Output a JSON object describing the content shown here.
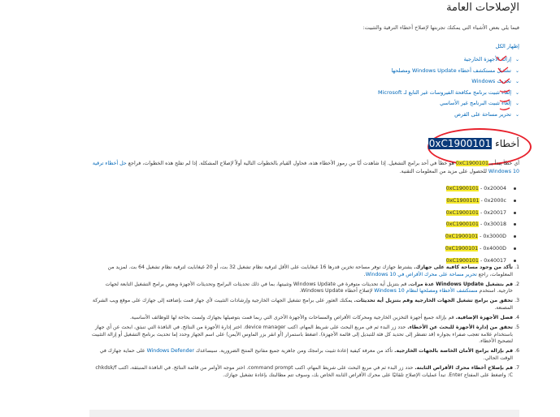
{
  "heading": "الإصلاحات العامة",
  "intro": "فيما يلي بعض الأشياء التي يمكنك تجربتها لإصلاح أخطاء الترقية والتثبيت:",
  "expand_all": "إظهار الكل",
  "fixes": [
    {
      "label": "إزالة الأجهزة الخارجية"
    },
    {
      "label": "تشغيل مستكشف أخطاء Windows Update ومصلحها"
    },
    {
      "label": "تحديث Windows"
    },
    {
      "label": "إلغاء تثبيت برنامج مكافحة الفيروسات غير التابع لـ Microsoft"
    },
    {
      "label": "إلغاء تثبيت البرنامج غير الأساسي"
    },
    {
      "label": "تحرير مساحة على القرص"
    }
  ],
  "error": {
    "title_prefix": "أخطاء",
    "code": "0xC1900101"
  },
  "paragraph": {
    "a": "أي خطأ يبدأ بـ ",
    "code": "0xC1900101",
    "b": " هو خطأ في أحد برامج التشغيل. إذا شاهدت أيًا من رموز الأخطاء هذه، فحاول القيام بالخطوات التالية أولاً لإصلاح المشكلة. إذا لم تفلح هذه الخطوات، فراجع ",
    "link": "حل أخطاء ترقية Windows 10",
    "c": " للحصول على مزيد من المعلومات التقنية."
  },
  "codes": [
    {
      "code": "0xC1900101",
      "suffix": " - 0x20004"
    },
    {
      "code": "0xC1900101",
      "suffix": " - 0x2000c"
    },
    {
      "code": "0xC1900101",
      "suffix": " - 0x20017"
    },
    {
      "code": "0xC1900101",
      "suffix": " - 0x30018"
    },
    {
      "code": "0xC1900101",
      "suffix": " - 0x3000D"
    },
    {
      "code": "0xC1900101",
      "suffix": " - 0x4000D"
    },
    {
      "code": "0xC1900101",
      "suffix": " - 0x40017"
    }
  ],
  "steps": [
    {
      "num": "1.",
      "bold": "تأكد من وجود مساحة كافية على جهازك.",
      "text": " يشترط جهازك توفر مساحة تخزين قدرها 16 غيغابايت على الأقل لترقية نظام تشغيل 32 بت، أو 20 غيغابايت لترقية نظام تشغيل 64 بت. لمزيد من المعلومات، راجع ",
      "link": "تحرير مساحة على محرك الأقراص في Windows 10",
      "tail": "."
    },
    {
      "num": "2.",
      "bold": "قم بتشغيل Windows Update عدة مرات.",
      "text": " قم بتنزيل أية تحديثات متوفرة في Windows Update وتثبيتها، بما في ذلك تحديثات البرامج وتحديثات الأجهزة وبعض برامج التشغيل التابعة لجهات خارجية. استخدم ",
      "link": "مستكشف الأخطاء ومصلحها لنظام Windows 10",
      "tail": " لإصلاح أخطاء Windows Update."
    },
    {
      "num": "3.",
      "bold": "تحقق من برامج تشغيل الجهات الخارجية وقم بتنزيل أية تحديثات.",
      "text": " يمكنك العثور على برامج تشغيل الجهات الخارجية وإرشادات التثبيت لأي جهاز قمت بإضافته إلى جهازك على موقع ويب الشركة المصنعة.",
      "link": "",
      "tail": ""
    },
    {
      "num": "4.",
      "bold": "فصل الأجهزة الإضافية.",
      "text": " قم بإزالة جميع أجهزة التخزين الخارجية ومحركات الأقراص والمساحات والأجهزة الأخرى التي ربما قمت بتوصيلها بجهازك ولست بحاجة لها للوظائف الأساسية.",
      "link": "",
      "tail": ""
    },
    {
      "num": "5.",
      "bold": "تحقق من إدارة الأجهزة للبحث عن الأخطاء.",
      "text": " حدد زر البدء ثم في مربع البحث على شريط المهام، اكتب device manager. اختر إدارة الأجهزة من النتائج. في النافذة التي تنبثق، ابحث عن أي جهاز باستخدام علامة تعجب صفراء بجواره (قد تضطر إلى تحديد كل فئة للتبديل إلى قائمة الأجهزة). اضغط باستمرار (أو انقر بزر الماوس الأيمن) على اسم الجهاز وحدد إما تحديث برنامج التشغيل أو إزالة التثبيت لتصحيح الأخطاء.",
      "link": "",
      "tail": ""
    },
    {
      "num": "6.",
      "bold": "قم بإزالة برامج الأمان الخاصة بالجهات الخارجية.",
      "text": " تأكد من معرفة كيفية إعادة تثبيت برامجك ومن جاهزية جميع مفاتيح المنتج الضرورية. سيساعدك ",
      "link": "Windows Defender",
      "tail": " على حماية جهازك في الوقت الحالي."
    },
    {
      "num": "7.",
      "bold": "قم بإصلاح أخطاء محرك الأقراص الثابتة.",
      "text": " حدد زر البدء ثم في مربع البحث على شريط المهام، اكتب command prompt. اختر موجه الأوامر من قائمة النتائج. في النافذة المنبثقة، اكتب chkdsk/f C: واضغط على المفتاح Enter. تبدأ عمليات الإصلاح تلقائيًا على محرك الأقراص الثابتة الخاص بك، وسوف تتم مطالبتك بإعادة تشغيل جهازك.",
      "link": "",
      "tail": ""
    }
  ],
  "colors": {
    "link": "#0067b8",
    "highlight": "#f5e82c",
    "annotation": "#e8212c",
    "selection": "#0a3a7a"
  }
}
